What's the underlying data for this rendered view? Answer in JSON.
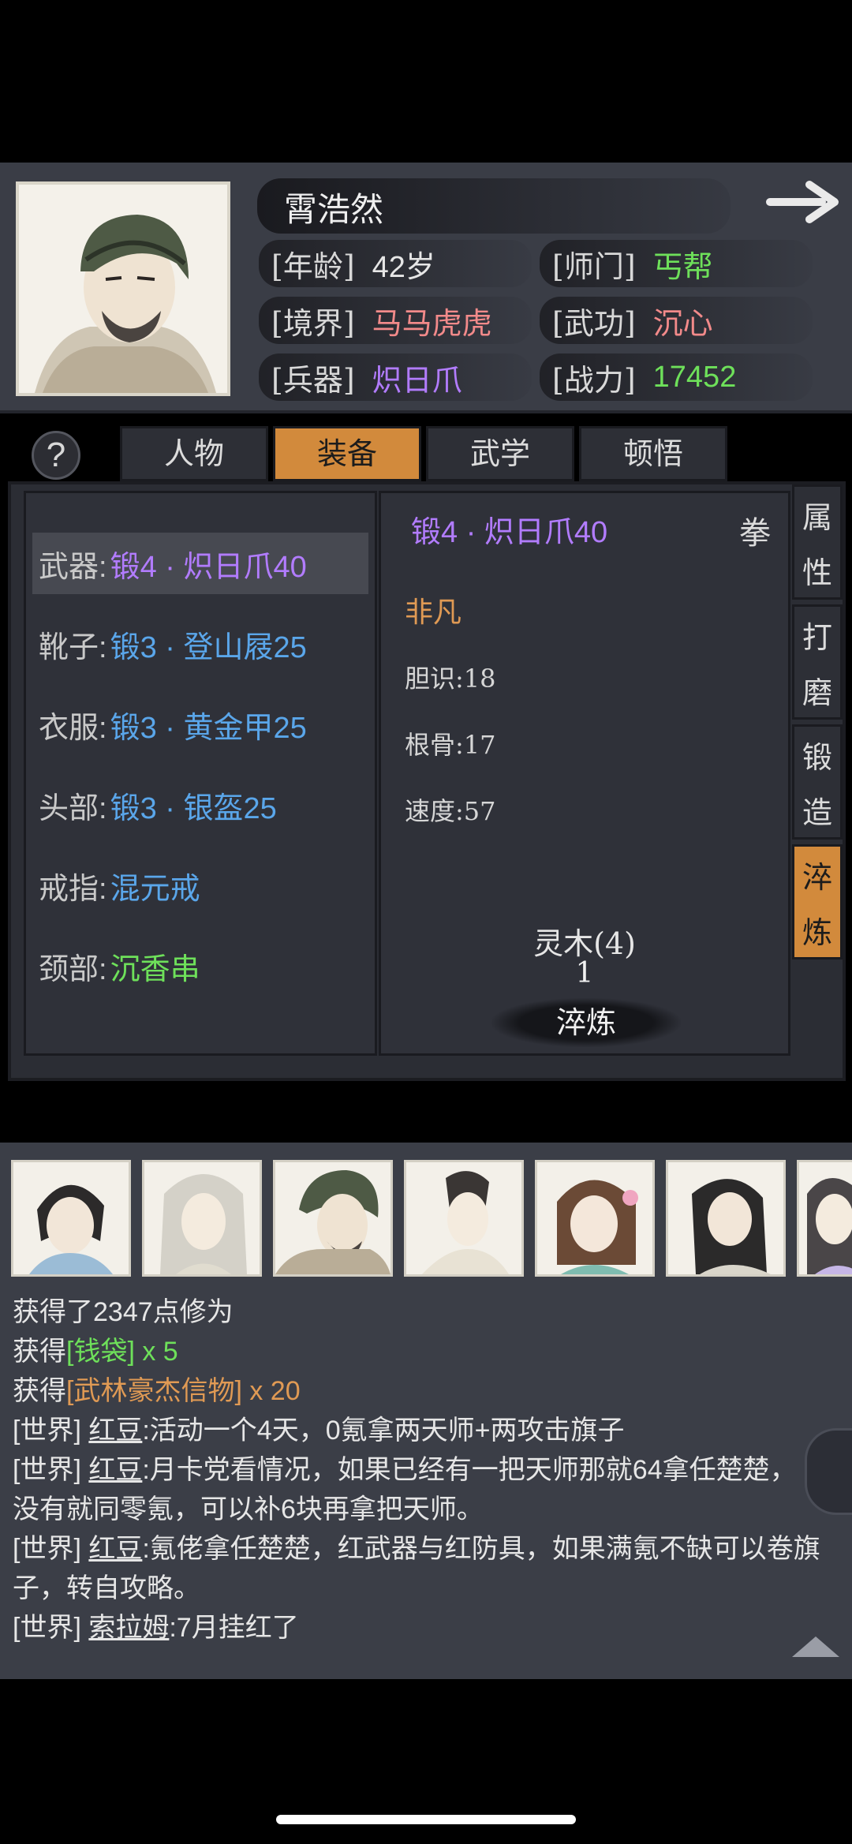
{
  "character": {
    "name": "霄浩然",
    "stats": [
      {
        "label": "[年龄]",
        "value": "42岁",
        "color": "#e6e6e6"
      },
      {
        "label": "[师门]",
        "value": "丐帮",
        "color": "#6ee05a"
      },
      {
        "label": "[境界]",
        "value": "马马虎虎",
        "color": "#f28a8a"
      },
      {
        "label": "[武功]",
        "value": "沉心",
        "color": "#f28a8a"
      },
      {
        "label": "[兵器]",
        "value": "炽日爪",
        "color": "#b27cff"
      },
      {
        "label": "[战力]",
        "value": "17452",
        "color": "#6ee05a"
      }
    ]
  },
  "tabs": [
    {
      "label": "人物",
      "active": false
    },
    {
      "label": "装备",
      "active": true
    },
    {
      "label": "武学",
      "active": false
    },
    {
      "label": "顿悟",
      "active": false
    }
  ],
  "help_label": "?",
  "equipment": [
    {
      "slot": "武器:",
      "item": "锻4 · 炽日爪40",
      "color": "#b27cff",
      "selected": true
    },
    {
      "slot": "靴子:",
      "item": "锻3 · 登山屐25",
      "color": "#5aa6ea",
      "selected": false
    },
    {
      "slot": "衣服:",
      "item": "锻3 · 黄金甲25",
      "color": "#5aa6ea",
      "selected": false
    },
    {
      "slot": "头部:",
      "item": "锻3 · 银盔25",
      "color": "#5aa6ea",
      "selected": false
    },
    {
      "slot": "戒指:",
      "item": "混元戒",
      "color": "#5aa6ea",
      "selected": false
    },
    {
      "slot": "颈部:",
      "item": "沉香串",
      "color": "#6ee05a",
      "selected": false
    }
  ],
  "detail": {
    "title": "锻4 · 炽日爪40",
    "type": "拳",
    "grade": "非凡",
    "stats": [
      "胆识:18",
      "根骨:17",
      "速度:57"
    ],
    "material": "灵木(4)",
    "material_count": "1",
    "action_label": "淬炼"
  },
  "side_tabs": [
    {
      "label_top": "属",
      "label_bottom": "性",
      "active": false
    },
    {
      "label_top": "打",
      "label_bottom": "磨",
      "active": false
    },
    {
      "label_top": "锻",
      "label_bottom": "造",
      "active": false
    },
    {
      "label_top": "淬",
      "label_bottom": "炼",
      "active": true
    }
  ],
  "log": {
    "line1": "获得了2347点修为",
    "line2_prefix": "获得",
    "line2_item": "[钱袋]",
    "line2_suffix": " x 5",
    "line3_prefix": "获得",
    "line3_item": "[武林豪杰信物]",
    "line3_suffix": " x 20",
    "chat": [
      {
        "channel": "[世界]",
        "user": "红豆",
        "text": ":活动一个4天，0氪拿两天师+两攻击旗子"
      },
      {
        "channel": "[世界]",
        "user": "红豆",
        "text": ":月卡党看情况，如果已经有一把天师那就64拿任楚楚，没有就同零氪，可以补6块再拿把天师。"
      },
      {
        "channel": "[世界]",
        "user": "红豆",
        "text": ":氪佬拿任楚楚，红武器与红防具，如果满氪不缺可以卷旗子，转自攻略。"
      },
      {
        "channel": "[世界]",
        "user": "索拉姆",
        "text": ":7月挂红了"
      }
    ]
  },
  "colors": {
    "gold_item": "#e09a54",
    "green_item": "#6ee05a"
  }
}
